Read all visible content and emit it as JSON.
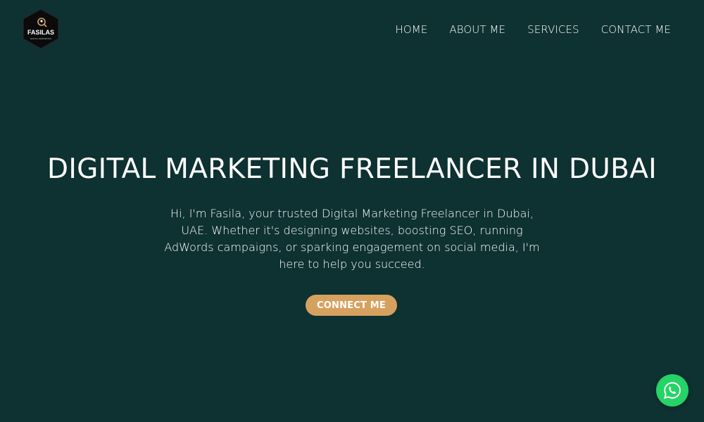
{
  "logo": {
    "text": "FASILAS",
    "tagline": "DIGITAL MARKETING"
  },
  "nav": {
    "items": [
      {
        "label": "HOME"
      },
      {
        "label": "ABOUT ME"
      },
      {
        "label": "SERVICES"
      },
      {
        "label": "CONTACT ME"
      }
    ]
  },
  "hero": {
    "title": "DIGITAL MARKETING FREELANCER IN DUBAI",
    "text": "Hi, I'm Fasila, your trusted Digital Marketing Freelancer in Dubai, UAE. Whether it's designing websites, boosting SEO, running AdWords campaigns, or sparking engagement on social media, I'm here to help you succeed.",
    "cta_label": "CONNECT ME"
  },
  "floating": {
    "icon": "whatsapp-icon"
  },
  "colors": {
    "background": "#0e3131",
    "accent": "#d6a15e",
    "whatsapp": "#25d366"
  }
}
